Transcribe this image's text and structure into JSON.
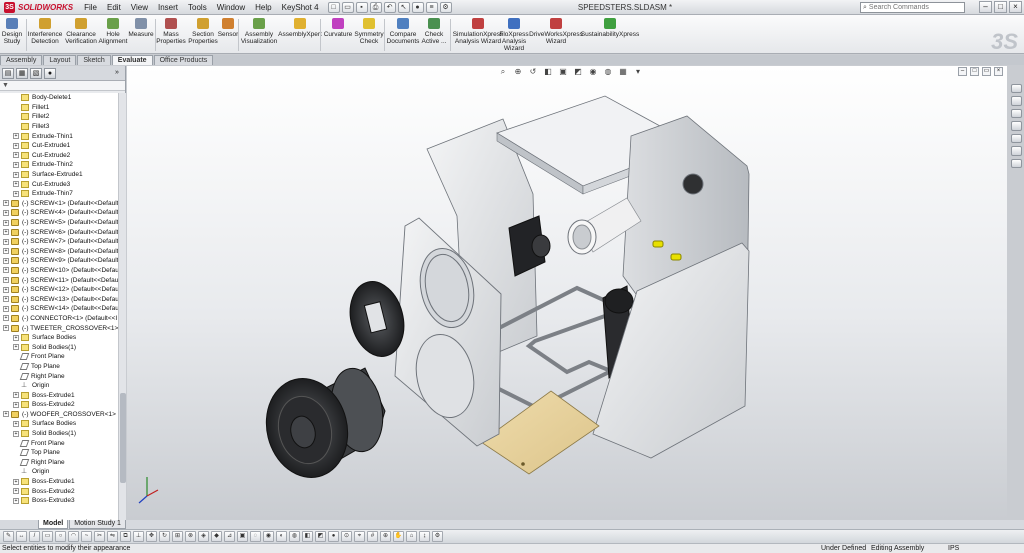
{
  "app": {
    "logo_text": "SOLIDWORKS",
    "document_title": "SPEEDSTERS.SLDASM *"
  },
  "menu": [
    "File",
    "Edit",
    "View",
    "Insert",
    "Tools",
    "Window",
    "Help",
    "KeyShot 4"
  ],
  "search": {
    "placeholder": "Search Commands"
  },
  "commands": [
    {
      "label": "Design\nStudy",
      "color": "#5a7fb8"
    },
    {
      "label": "Interference\nDetection",
      "color": "#d0a030"
    },
    {
      "label": "Clearance\nVerification",
      "color": "#d0a030"
    },
    {
      "label": "Hole\nAlignment",
      "color": "#6aa04a"
    },
    {
      "label": "Measure",
      "color": "#8090a8"
    },
    {
      "label": "Mass\nProperties",
      "color": "#b05050"
    },
    {
      "label": "Section\nProperties",
      "color": "#d0a030"
    },
    {
      "label": "Sensor",
      "color": "#d08030"
    },
    {
      "label": "Assembly\nVisualization",
      "color": "#6aa04a"
    },
    {
      "label": "AssemblyXpert",
      "color": "#e0b030"
    },
    {
      "label": "Curvature",
      "color": "#c040c0"
    },
    {
      "label": "Symmetry\nCheck",
      "color": "#e0c030"
    },
    {
      "label": "Compare\nDocuments",
      "color": "#5080c0"
    },
    {
      "label": "Check\nActive ...",
      "color": "#4a9050"
    },
    {
      "label": "SimulationXpress\nAnalysis Wizard",
      "color": "#c04040"
    },
    {
      "label": "FloXpress\nAnalysis\nWizard",
      "color": "#4070c0"
    },
    {
      "label": "DriveWorksXpress\nWizard",
      "color": "#c04040"
    },
    {
      "label": "SustainabilityXpress",
      "color": "#40a040"
    }
  ],
  "tabs": [
    "Assembly",
    "Layout",
    "Sketch",
    "Evaluate",
    "Office Products"
  ],
  "active_tab": "Evaluate",
  "tree": [
    {
      "label": "Body-Delete1",
      "indent": 1,
      "icon": "feature"
    },
    {
      "label": "Fillet1",
      "indent": 1,
      "icon": "feature"
    },
    {
      "label": "Fillet2",
      "indent": 1,
      "icon": "feature"
    },
    {
      "label": "Fillet3",
      "indent": 1,
      "icon": "feature"
    },
    {
      "label": "Extrude-Thin1",
      "indent": 1,
      "icon": "feature",
      "exp": true
    },
    {
      "label": "Cut-Extrude1",
      "indent": 1,
      "icon": "feature",
      "exp": true
    },
    {
      "label": "Cut-Extrude2",
      "indent": 1,
      "icon": "feature",
      "exp": true
    },
    {
      "label": "Extrude-Thin2",
      "indent": 1,
      "icon": "feature",
      "exp": true
    },
    {
      "label": "Surface-Extrude1",
      "indent": 1,
      "icon": "feature",
      "exp": true
    },
    {
      "label": "Cut-Extrude3",
      "indent": 1,
      "icon": "feature",
      "exp": true
    },
    {
      "label": "Extrude-Thin7",
      "indent": 1,
      "icon": "feature",
      "exp": true
    },
    {
      "label": "(-) SCREW<1> (Default<<Default",
      "indent": 0,
      "icon": "asm",
      "exp": true
    },
    {
      "label": "(-) SCREW<4> (Default<<Default",
      "indent": 0,
      "icon": "asm",
      "exp": true
    },
    {
      "label": "(-) SCREW<5> (Default<<Default",
      "indent": 0,
      "icon": "asm",
      "exp": true
    },
    {
      "label": "(-) SCREW<6> (Default<<Default",
      "indent": 0,
      "icon": "asm",
      "exp": true
    },
    {
      "label": "(-) SCREW<7> (Default<<Default",
      "indent": 0,
      "icon": "asm",
      "exp": true
    },
    {
      "label": "(-) SCREW<8> (Default<<Default",
      "indent": 0,
      "icon": "asm",
      "exp": true
    },
    {
      "label": "(-) SCREW<9> (Default<<Default",
      "indent": 0,
      "icon": "asm",
      "exp": true
    },
    {
      "label": "(-) SCREW<10> (Default<<Defau",
      "indent": 0,
      "icon": "asm",
      "exp": true
    },
    {
      "label": "(-) SCREW<11> (Default<<Defau",
      "indent": 0,
      "icon": "asm",
      "exp": true
    },
    {
      "label": "(-) SCREW<12> (Default<<Defau",
      "indent": 0,
      "icon": "asm",
      "exp": true
    },
    {
      "label": "(-) SCREW<13> (Default<<Defau",
      "indent": 0,
      "icon": "asm",
      "exp": true
    },
    {
      "label": "(-) SCREW<14> (Default<<Defau",
      "indent": 0,
      "icon": "asm",
      "exp": true
    },
    {
      "label": "(-) CONNECTOR<1> (Default<<I",
      "indent": 0,
      "icon": "asm",
      "exp": true
    },
    {
      "label": "(-) TWEETER_CROSSOVER<1> (D",
      "indent": 0,
      "icon": "asm",
      "exp": true
    },
    {
      "label": "Surface Bodies",
      "indent": 1,
      "icon": "feature",
      "exp": true
    },
    {
      "label": "Solid Bodies(1)",
      "indent": 1,
      "icon": "feature",
      "exp": true
    },
    {
      "label": "Front Plane",
      "indent": 1,
      "icon": "plane"
    },
    {
      "label": "Top Plane",
      "indent": 1,
      "icon": "plane"
    },
    {
      "label": "Right Plane",
      "indent": 1,
      "icon": "plane"
    },
    {
      "label": "Origin",
      "indent": 1,
      "icon": "origin"
    },
    {
      "label": "Boss-Extrude1",
      "indent": 1,
      "icon": "feature",
      "exp": true
    },
    {
      "label": "Boss-Extrude2",
      "indent": 1,
      "icon": "feature",
      "exp": true
    },
    {
      "label": "(-) WOOFER_CROSSOVER<1> (De",
      "indent": 0,
      "icon": "asm",
      "exp": true
    },
    {
      "label": "Surface Bodies",
      "indent": 1,
      "icon": "feature",
      "exp": true
    },
    {
      "label": "Solid Bodies(1)",
      "indent": 1,
      "icon": "feature",
      "exp": true
    },
    {
      "label": "Front Plane",
      "indent": 1,
      "icon": "plane"
    },
    {
      "label": "Top Plane",
      "indent": 1,
      "icon": "plane"
    },
    {
      "label": "Right Plane",
      "indent": 1,
      "icon": "plane"
    },
    {
      "label": "Origin",
      "indent": 1,
      "icon": "origin"
    },
    {
      "label": "Boss-Extrude1",
      "indent": 1,
      "icon": "feature",
      "exp": true
    },
    {
      "label": "Boss-Extrude2",
      "indent": 1,
      "icon": "feature",
      "exp": true
    },
    {
      "label": "Boss-Extrude3",
      "indent": 1,
      "icon": "feature",
      "exp": true
    }
  ],
  "bottom_tabs": [
    "Model",
    "Motion Study 1"
  ],
  "status": {
    "message": "Select entities to modify their appearance",
    "defined": "Under Defined",
    "mode": "Editing Assembly",
    "units": "IPS"
  },
  "colors": {
    "panel_gray": "#c8ccd2",
    "panel_edge": "#6e737a",
    "speaker_black": "#2a2a2a",
    "wood": "#e6d2a0",
    "tube_white": "#f2f2f2",
    "connector_yellow": "#e8e000"
  }
}
